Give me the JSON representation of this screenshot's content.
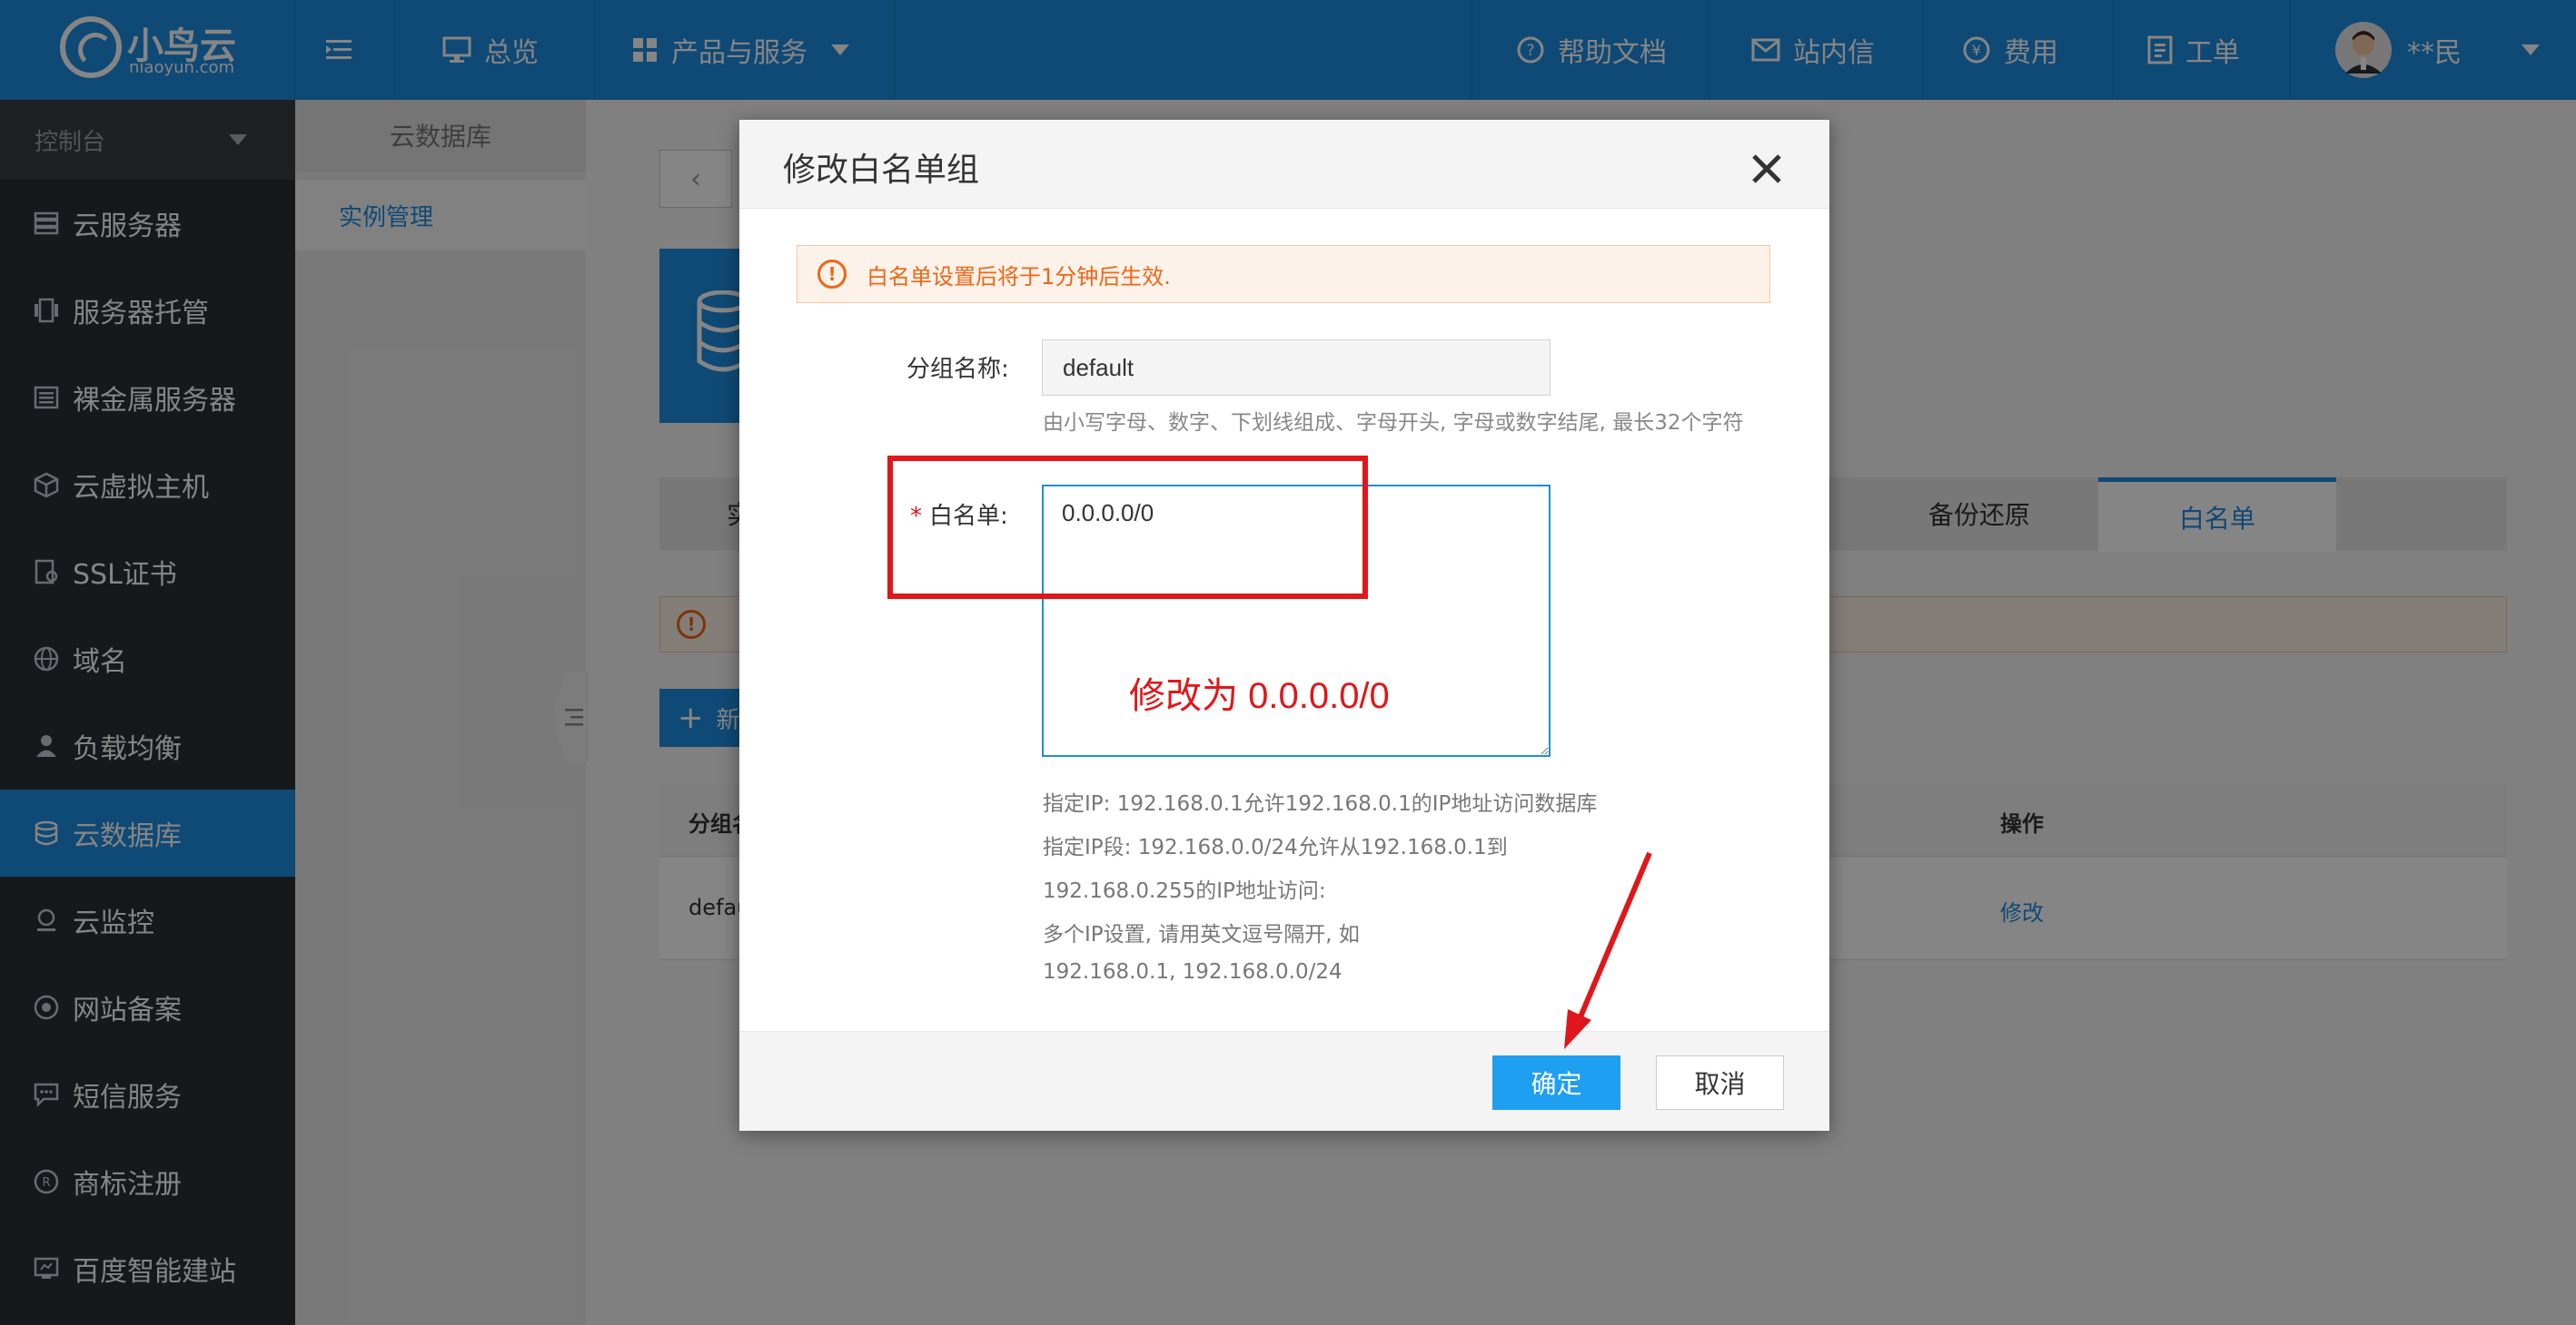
{
  "brand": {
    "name": "小鸟云",
    "sub": "niaoyun.com"
  },
  "topbar": {
    "menu_toggle": "≡",
    "overview": "总览",
    "products": "产品与服务",
    "docs": "帮助文档",
    "messages": "站内信",
    "billing": "费用",
    "tickets": "工单",
    "user": "**民"
  },
  "sidebar": {
    "console": "控制台",
    "items": [
      {
        "label": "云服务器",
        "icon": "server-icon"
      },
      {
        "label": "服务器托管",
        "icon": "hosting-icon"
      },
      {
        "label": "裸金属服务器",
        "icon": "bare-metal-icon"
      },
      {
        "label": "云虚拟主机",
        "icon": "cube-icon"
      },
      {
        "label": "SSL证书",
        "icon": "certificate-icon"
      },
      {
        "label": "域名",
        "icon": "globe-icon"
      },
      {
        "label": "负载均衡",
        "icon": "balance-icon"
      },
      {
        "label": "云数据库",
        "icon": "database-icon",
        "active": true
      },
      {
        "label": "云监控",
        "icon": "monitor-icon"
      },
      {
        "label": "网站备案",
        "icon": "record-icon"
      },
      {
        "label": "短信服务",
        "icon": "sms-icon"
      },
      {
        "label": "商标注册",
        "icon": "trademark-icon"
      },
      {
        "label": "百度智能建站",
        "icon": "site-icon"
      }
    ]
  },
  "subnav": {
    "title": "云数据库",
    "item": "实例管理"
  },
  "page": {
    "tab_partial": "实",
    "tab_backup": "备份还原",
    "tab_whitelist": "白名单",
    "add_button": "新",
    "col_group": "分组名",
    "col_action": "操作",
    "row_name": "defau",
    "row_action": "修改"
  },
  "modal": {
    "title": "修改白名单组",
    "alert": "白名单设置后将于1分钟后生效.",
    "group_label": "分组名称:",
    "group_value": "default",
    "group_hint": "由小写字母、数字、下划线组成、字母开头, 字母或数字结尾, 最长32个字符",
    "whitelist_required": "*",
    "whitelist_label": "白名单:",
    "whitelist_value": "0.0.0.0/0",
    "hints": [
      "指定IP: 192.168.0.1允许192.168.0.1的IP地址访问数据库",
      "指定IP段: 192.168.0.0/24允许从192.168.0.1到",
      "192.168.0.255的IP地址访问:",
      "多个IP设置, 请用英文逗号隔开, 如",
      "192.168.0.1, 192.168.0.0/24"
    ],
    "ok": "确定",
    "cancel": "取消"
  },
  "annotation": {
    "note": "修改为 0.0.0.0/0",
    "color": "#e0171a"
  },
  "colors": {
    "primary": "#1e8de0",
    "sidebar": "#2a3036",
    "warning": "#f06414"
  }
}
